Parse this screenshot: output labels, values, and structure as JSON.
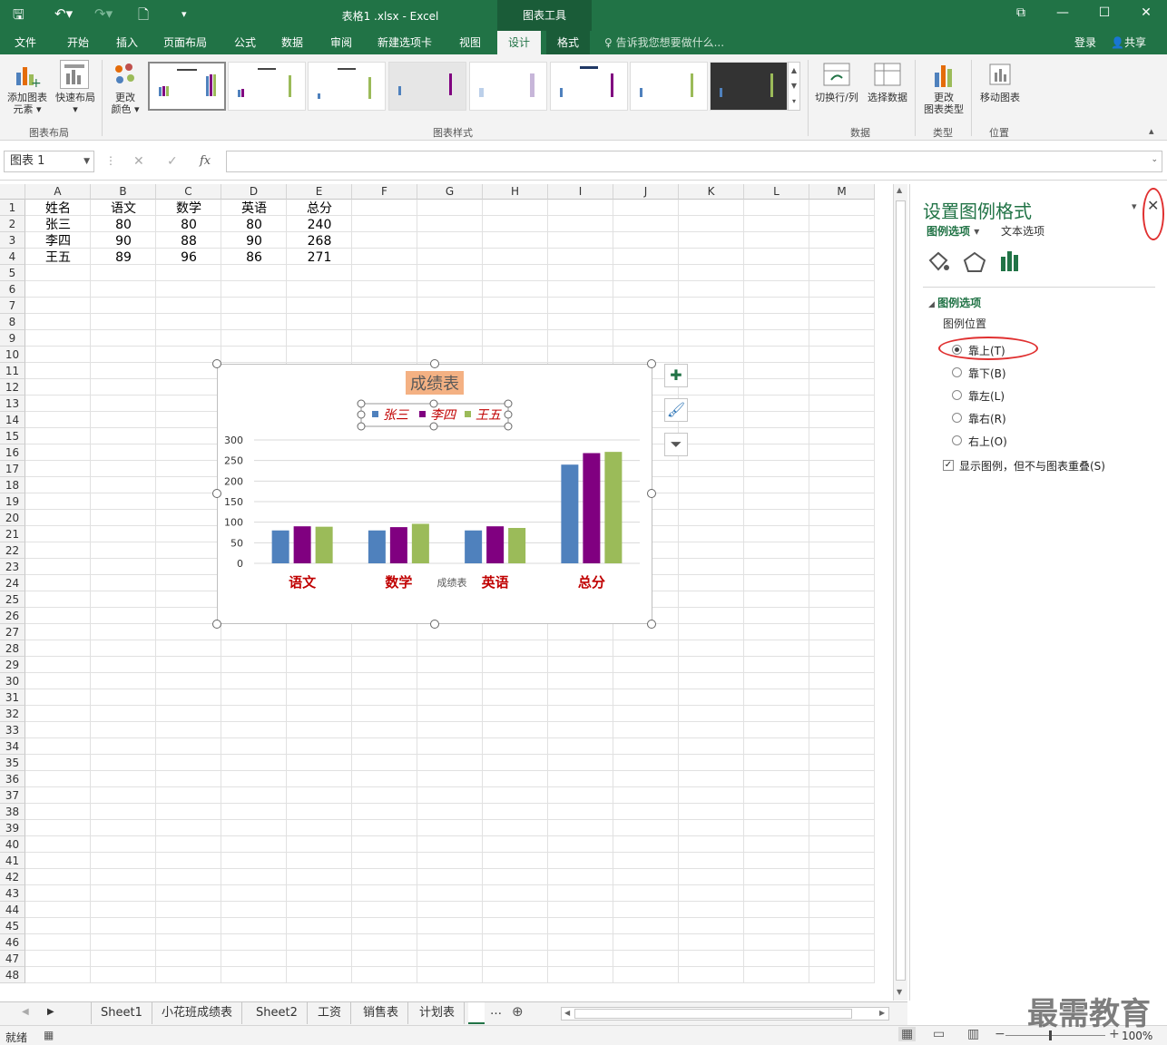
{
  "titlebar": {
    "doc_title": "表格1 .xlsx - Excel",
    "tools_label": "图表工具"
  },
  "tabs": [
    "文件",
    "开始",
    "插入",
    "页面布局",
    "公式",
    "数据",
    "审阅",
    "新建选项卡",
    "视图",
    "设计",
    "格式"
  ],
  "tell_me": "告诉我您想要做什么...",
  "login": "登录",
  "share": "共享",
  "ribbon": {
    "add_element_1": "添加图表",
    "add_element_2": "元素",
    "quick_layout": "快速布局",
    "change_color_1": "更改",
    "change_color_2": "颜色",
    "group_layout": "图表布局",
    "group_styles": "图表样式",
    "switch_rowcol": "切换行/列",
    "select_data": "选择数据",
    "group_data": "数据",
    "change_type_1": "更改",
    "change_type_2": "图表类型",
    "group_type": "类型",
    "move_chart": "移动图表",
    "group_location": "位置"
  },
  "namebox": "图表 1",
  "columns": [
    "A",
    "B",
    "C",
    "D",
    "E",
    "F",
    "G",
    "H",
    "I",
    "J",
    "K",
    "L",
    "M"
  ],
  "rows": [
    "1",
    "2",
    "3",
    "4",
    "5",
    "6",
    "7",
    "8",
    "9",
    "10",
    "11",
    "12",
    "13",
    "14",
    "15",
    "16",
    "17",
    "18",
    "19",
    "20",
    "21",
    "22",
    "23",
    "24",
    "25",
    "26",
    "27",
    "28",
    "29",
    "30",
    "31",
    "32",
    "33",
    "34",
    "35",
    "36",
    "37",
    "38",
    "39",
    "40",
    "41",
    "42",
    "43",
    "44",
    "45",
    "46",
    "47",
    "48"
  ],
  "table": {
    "header": [
      "姓名",
      "语文",
      "数学",
      "英语",
      "总分"
    ],
    "rows": [
      [
        "张三",
        "80",
        "80",
        "80",
        "240"
      ],
      [
        "李四",
        "90",
        "88",
        "90",
        "268"
      ],
      [
        "王五",
        "89",
        "96",
        "86",
        "271"
      ]
    ]
  },
  "chart_data": {
    "type": "bar",
    "title": "成绩表",
    "categories": [
      "语文",
      "数学",
      "英语",
      "总分"
    ],
    "series": [
      {
        "name": "张三",
        "values": [
          80,
          80,
          80,
          240
        ],
        "color": "#4f81bd"
      },
      {
        "name": "李四",
        "values": [
          90,
          88,
          90,
          268
        ],
        "color": "#800080"
      },
      {
        "name": "王五",
        "values": [
          89,
          96,
          86,
          271
        ],
        "color": "#9bbb59"
      }
    ],
    "ylim": [
      0,
      300
    ],
    "yticks": [
      "300",
      "250",
      "200",
      "150",
      "100",
      "50",
      "0"
    ],
    "xlabel": "成绩表",
    "legend_position": "top",
    "grid": true
  },
  "pane": {
    "title": "设置图例格式",
    "tab_legend": "图例选项",
    "tab_text": "文本选项",
    "section": "图例选项",
    "position_label": "图例位置",
    "options": [
      "靠上(T)",
      "靠下(B)",
      "靠左(L)",
      "靠右(R)",
      "右上(O)"
    ],
    "selected": "靠上(T)",
    "overlay": "显示图例，但不与图表重叠(S)"
  },
  "sheets": [
    "Sheet1",
    "小花班成绩表",
    "Sheet2",
    "工资",
    "销售表",
    "计划表"
  ],
  "status": {
    "ready": "就绪",
    "zoom": "100%"
  },
  "watermark": "最需教育"
}
